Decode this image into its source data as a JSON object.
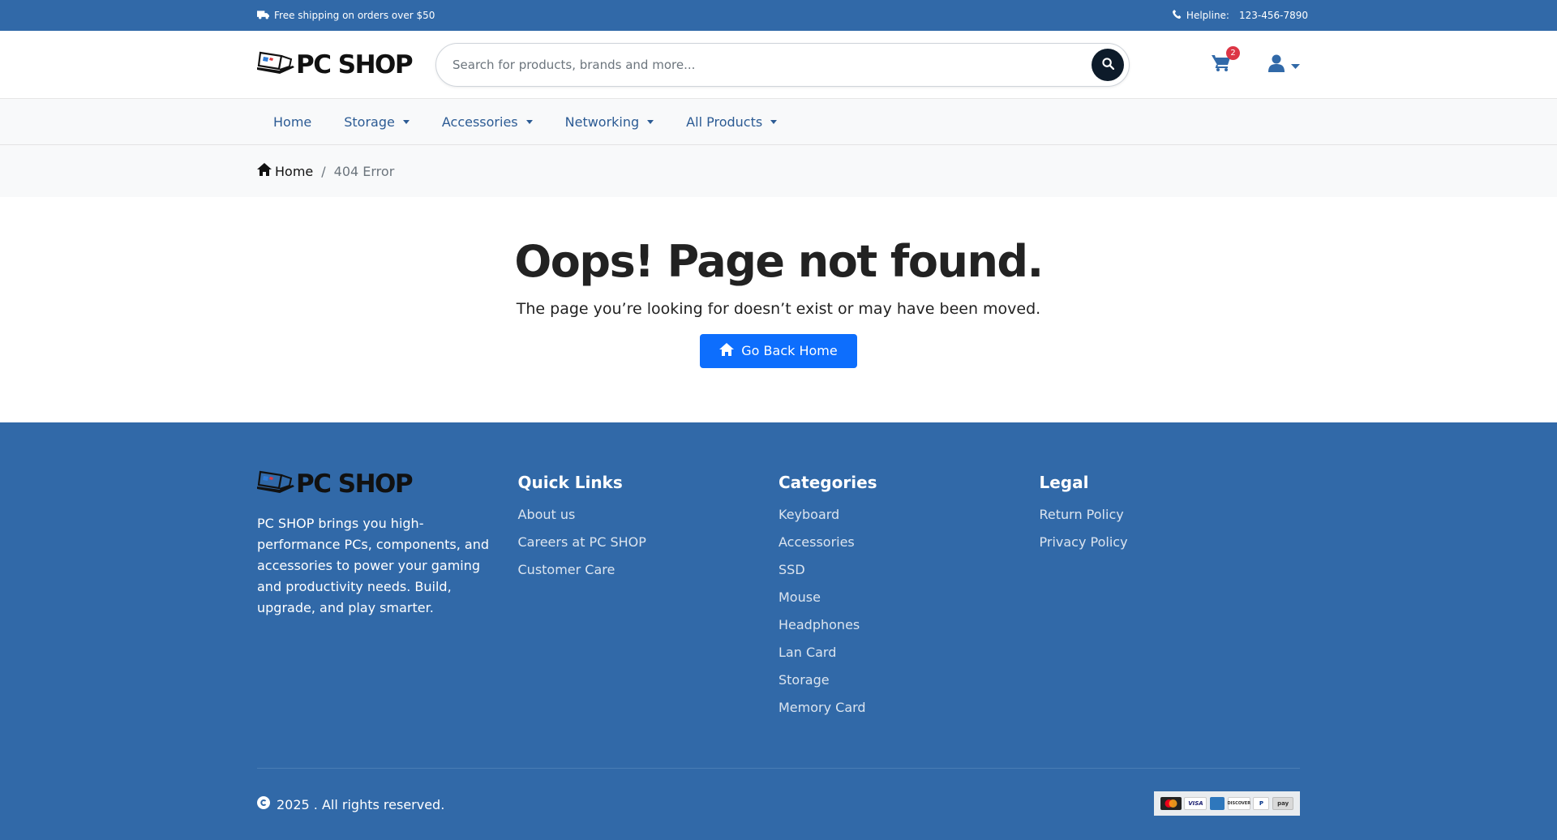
{
  "topbar": {
    "shipping_text": "Free shipping on orders over $50",
    "helpline_label": "Helpline:",
    "helpline_number": "123-456-7890"
  },
  "header": {
    "logo_text": "PC SHOP",
    "search_placeholder": "Search for products, brands and more...",
    "cart_count": "2"
  },
  "nav": {
    "items": [
      {
        "label": "Home",
        "dropdown": false
      },
      {
        "label": "Storage",
        "dropdown": true
      },
      {
        "label": "Accessories",
        "dropdown": true
      },
      {
        "label": "Networking",
        "dropdown": true
      },
      {
        "label": "All Products",
        "dropdown": true
      }
    ]
  },
  "breadcrumb": {
    "home": "Home",
    "separator": "/",
    "current": "404 Error"
  },
  "main": {
    "title": "Oops! Page not found.",
    "message": "The page you’re looking for doesn’t exist or may have been moved.",
    "button_label": "Go Back Home"
  },
  "footer": {
    "logo_text": "PC SHOP",
    "description": "PC SHOP brings you high-performance PCs, components, and accessories to power your gaming and productivity needs. Build, upgrade, and play smarter.",
    "quick_links": {
      "title": "Quick Links",
      "items": [
        "About us",
        "Careers at PC SHOP",
        "Customer Care"
      ]
    },
    "categories": {
      "title": "Categories",
      "items": [
        "Keyboard",
        "Accessories",
        "SSD",
        "Mouse",
        "Headphones",
        "Lan Card",
        "Storage",
        "Memory Card"
      ]
    },
    "legal": {
      "title": "Legal",
      "items": [
        "Return Policy",
        "Privacy Policy"
      ]
    },
    "copyright": "2025 . All rights reserved.",
    "payment_icons": [
      "mastercard-icon",
      "visa-icon",
      "amex-icon",
      "discover-icon",
      "paypal-icon",
      "pay-icon"
    ]
  },
  "colors": {
    "brand_blue": "#3169a8",
    "nav_link": "#2c5b94",
    "primary_button": "#0d6efd",
    "badge_red": "#dc3545"
  }
}
